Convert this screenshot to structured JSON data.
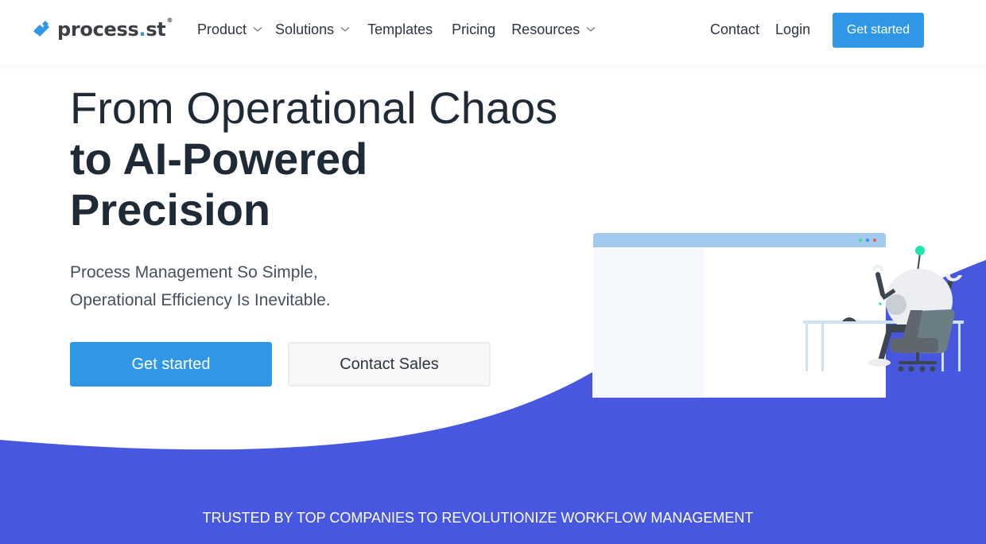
{
  "brand": {
    "name": "process",
    "dot": ".",
    "suffix": "st",
    "registered": "®",
    "primary_color": "#2f97e6",
    "wave_color": "#4857df"
  },
  "nav": {
    "items": [
      {
        "label": "Product",
        "has_dropdown": true,
        "icon": "chevron-down-icon"
      },
      {
        "label": "Solutions",
        "has_dropdown": true,
        "icon": "chevron-down-icon"
      },
      {
        "label": "Templates",
        "has_dropdown": false
      },
      {
        "label": "Pricing",
        "has_dropdown": false
      },
      {
        "label": "Resources",
        "has_dropdown": true,
        "icon": "chevron-down-icon"
      }
    ],
    "contact_label": "Contact",
    "login_label": "Login",
    "cta_label": "Get started"
  },
  "hero": {
    "title_light": "From Operational Chaos",
    "title_bold_line1": "to AI-Powered",
    "title_bold_line2": "Precision",
    "subtitle_line1": "Process Management So Simple,",
    "subtitle_line2": "Operational Efficiency Is Inevitable.",
    "primary_button": "Get started",
    "secondary_button": "Contact Sales"
  },
  "illustration": {
    "subject": "robot working at desk in browser window",
    "window_dots": [
      "#3ddc97",
      "#2f97e6",
      "#f2545b"
    ]
  },
  "trusted": {
    "text": "TRUSTED BY TOP COMPANIES TO REVOLUTIONIZE WORKFLOW MANAGEMENT"
  }
}
